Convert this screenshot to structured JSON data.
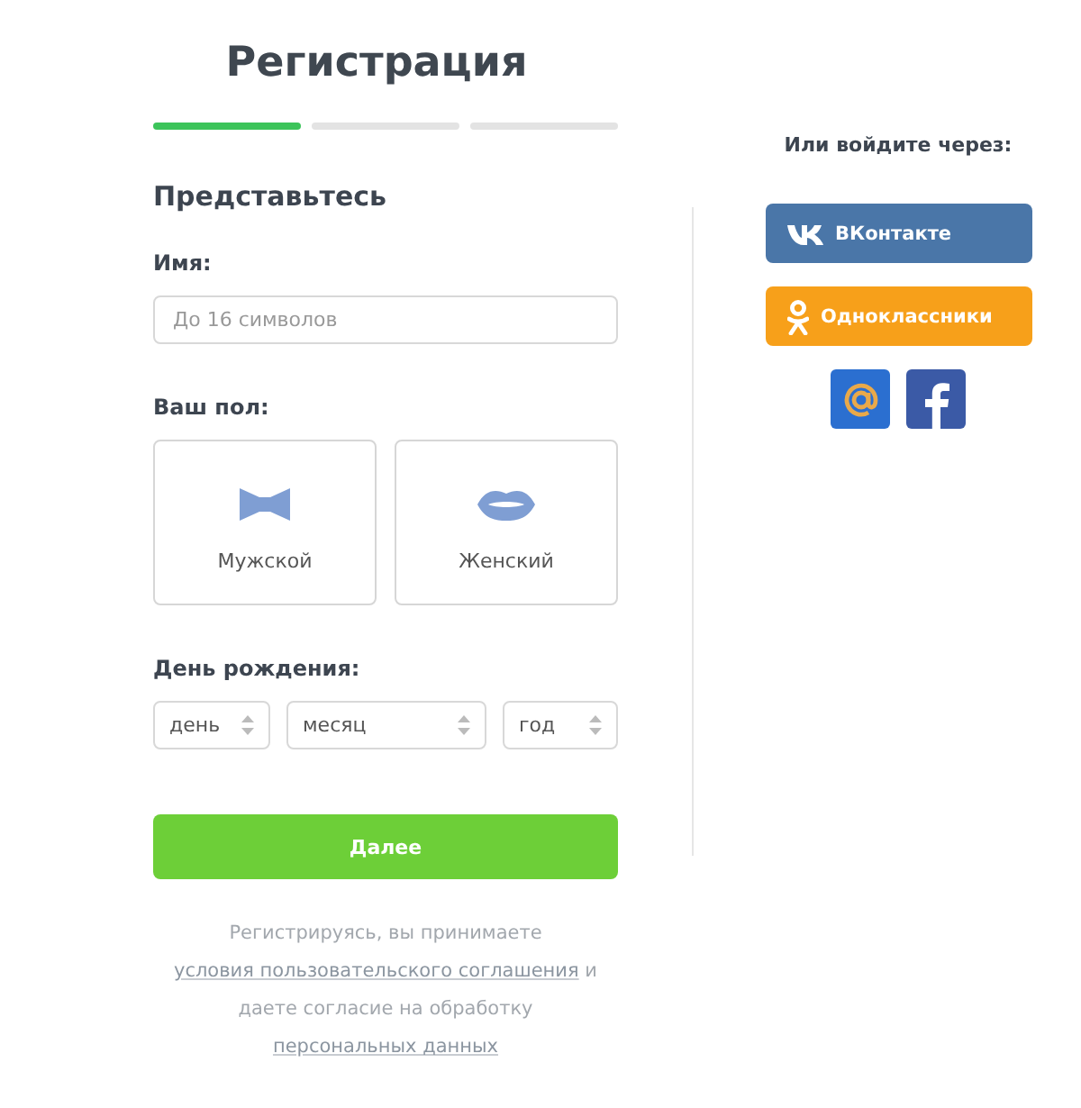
{
  "title": "Регистрация",
  "steps": [
    {
      "completed": true
    },
    {
      "completed": false
    },
    {
      "completed": false
    }
  ],
  "section_title": "Представьтесь",
  "name_field": {
    "label": "Имя:",
    "placeholder": "До 16 символов"
  },
  "gender": {
    "label": "Ваш пол:",
    "options": [
      {
        "kind": "bowtie",
        "label": "Мужской",
        "selected": false
      },
      {
        "kind": "lips",
        "label": "Женский",
        "selected": false
      }
    ]
  },
  "birthday": {
    "label": "День рождения:",
    "selects": [
      {
        "kind": "day",
        "value": "день"
      },
      {
        "kind": "month",
        "value": "месяц"
      },
      {
        "kind": "year",
        "value": "год"
      }
    ]
  },
  "next_button": "Далее",
  "terms": [
    {
      "kind": "text",
      "text": "Регистрируясь, вы принимаете"
    },
    {
      "kind": "link",
      "text": "условия пользовательского соглашения"
    },
    {
      "kind": "text",
      "text": "и даете согласие на обработку"
    },
    {
      "kind": "link",
      "text": "персональных данных"
    }
  ],
  "social": {
    "title": "Или войдите через:",
    "buttons": [
      {
        "kind": "vk",
        "label": "ВКонтакте"
      },
      {
        "kind": "ok",
        "label": "Одноклассники"
      }
    ],
    "icons": [
      {
        "kind": "mail"
      },
      {
        "kind": "facebook"
      }
    ]
  }
}
